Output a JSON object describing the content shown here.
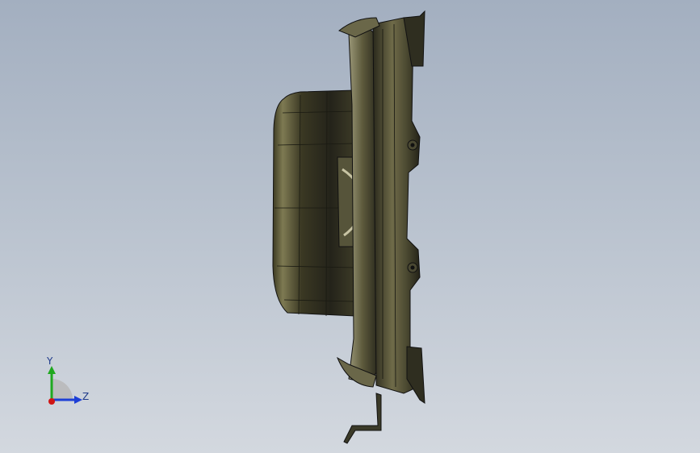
{
  "viewport": {
    "background_top": "#a3afc0",
    "background_bottom": "#d3d8df",
    "model_description_icon": "cad-part-side-view"
  },
  "triad": {
    "y_label": "Y",
    "z_label": "Z",
    "colors": {
      "y": "#1fa81f",
      "z": "#1d3fd6",
      "x": "#d01515"
    }
  }
}
